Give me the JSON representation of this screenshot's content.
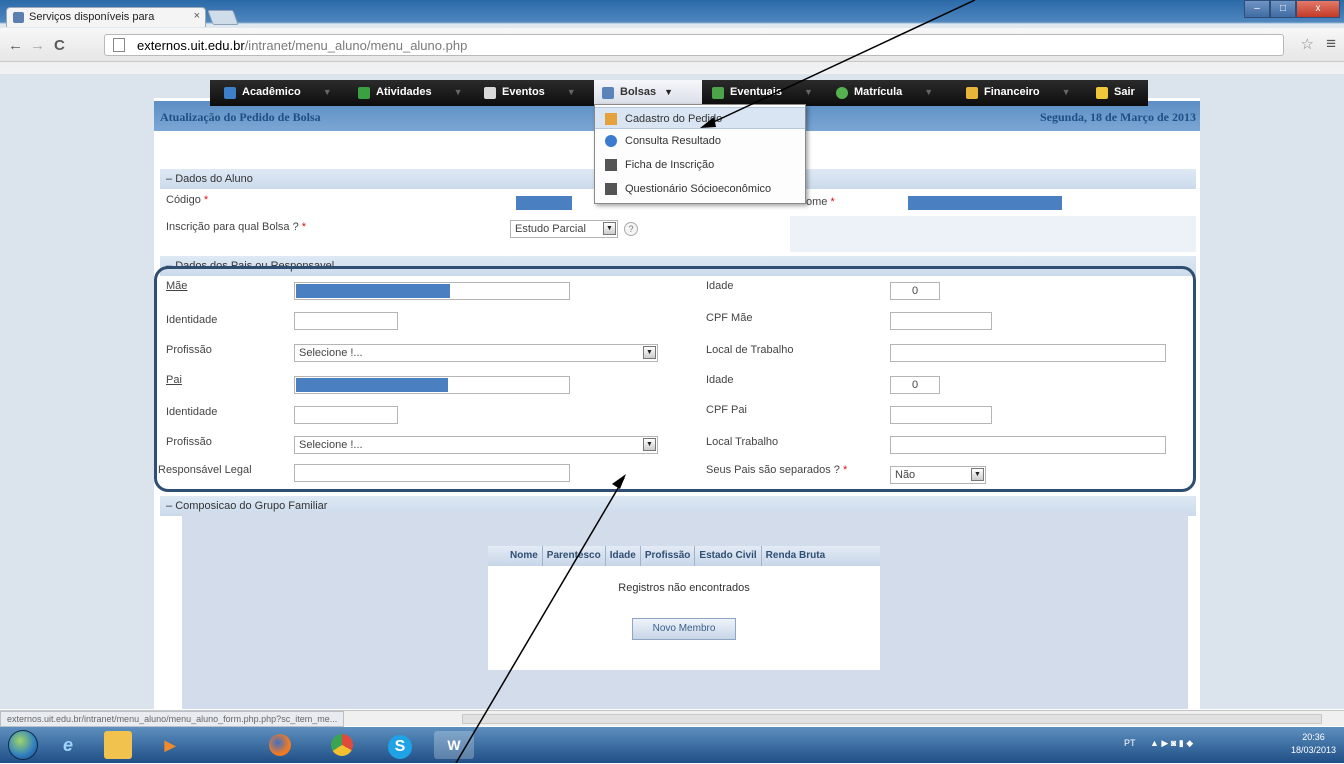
{
  "browser": {
    "tab_title": "Serviços disponíveis para",
    "tab_close": "×",
    "url_host": "externos.uit.edu.br",
    "url_path": "/intranet/menu_aluno/menu_aluno.php",
    "back": "←",
    "forward": "→",
    "reload": "C",
    "star": "☆",
    "menu": "≡",
    "min": "–",
    "max": "□",
    "close": "x"
  },
  "topmenu": {
    "items": [
      {
        "label": "Acadêmico",
        "icon_color": "#3d7fc8"
      },
      {
        "label": "Atividades",
        "icon_color": "#3aa040"
      },
      {
        "label": "Eventos",
        "icon_color": "#d9d9d9"
      },
      {
        "label": "Bolsas",
        "icon_color": "#5b83b8"
      },
      {
        "label": "Eventuais",
        "icon_color": "#4da34a"
      },
      {
        "label": "Matrícula",
        "icon_color": "#55b050"
      },
      {
        "label": "Financeiro",
        "icon_color": "#e8b43a"
      },
      {
        "label": "Sair",
        "icon_color": "#f0c63b"
      }
    ],
    "caret": "▼"
  },
  "dropdown": {
    "items": [
      {
        "label": "Cadastro do Pedido",
        "icon_color": "#e6a23a"
      },
      {
        "label": "Consulta Resultado",
        "icon_color": "#3c7ad0"
      },
      {
        "label": "Ficha de Inscrição",
        "icon_color": "#555555"
      },
      {
        "label": "Questionário Sócioeconômico",
        "icon_color": "#555555"
      }
    ]
  },
  "page": {
    "title": "Atualização do Pedido de Bolsa",
    "date": "Segunda, 18 de Março de 2013"
  },
  "aluno": {
    "section": "Dados do Aluno",
    "codigo_label": "Código",
    "nome_label": "ome",
    "inscricao_label": "Inscrição para qual Bolsa ?",
    "inscricao_value": "Estudo Parcial",
    "required_mark": "*",
    "help": "?"
  },
  "pais": {
    "section": "Dados dos Pais ou Responsavel",
    "mae_label": "Mãe",
    "idade_label": "Idade",
    "idade_mae_value": "0",
    "identidade_label": "Identidade",
    "cpf_mae_label": "CPF Mãe",
    "profissao_label": "Profissão",
    "select_placeholder": "Selecione !...",
    "local_trabalho_mae_label": "Local de Trabalho",
    "pai_label": "Pai",
    "idade_pai_value": "0",
    "cpf_pai_label": "CPF Pai",
    "local_trabalho_pai_label": "Local Trabalho",
    "responsavel_label": "Responsável Legal",
    "separados_label": "Seus Pais são separados ?",
    "separados_value": "Não"
  },
  "familia": {
    "section": "Composicao do Grupo Familiar",
    "columns": [
      "Nome",
      "Parentesco",
      "Idade",
      "Profissão",
      "Estado Civil",
      "Renda Bruta"
    ],
    "empty_message": "Registros não encontrados",
    "new_button": "Novo Membro"
  },
  "status_url": "externos.uit.edu.br/intranet/menu_aluno/menu_aluno_form.php.php?sc_item_me...",
  "taskbar": {
    "lang": "PT",
    "time": "20:36",
    "date": "18/03/2013"
  }
}
